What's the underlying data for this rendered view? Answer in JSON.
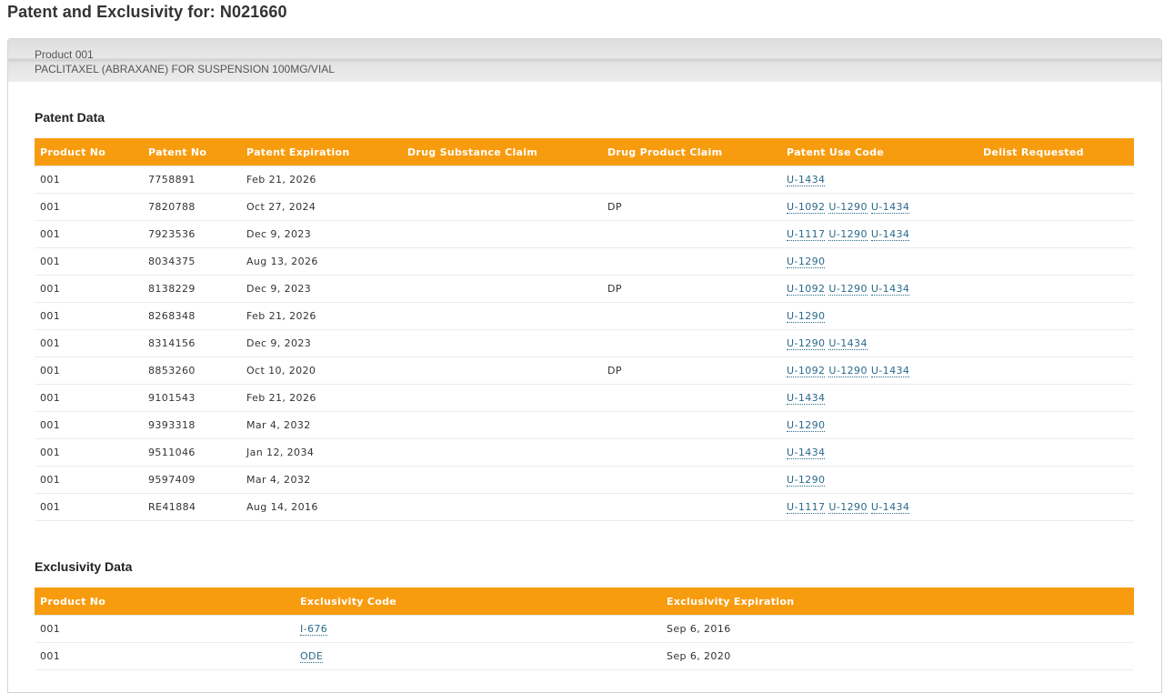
{
  "page_title": "Patent and Exclusivity for: N021660",
  "product": {
    "label": "Product 001",
    "description": "PACLITAXEL (ABRAXANE) FOR SUSPENSION 100MG/VIAL"
  },
  "patent_section": {
    "title": "Patent Data",
    "columns": [
      "Product No",
      "Patent No",
      "Patent Expiration",
      "Drug Substance Claim",
      "Drug Product Claim",
      "Patent Use Code",
      "Delist Requested"
    ],
    "rows": [
      {
        "product_no": "001",
        "patent_no": "7758891",
        "expiration": "Feb 21, 2026",
        "substance": "",
        "product_claim": "",
        "use_codes": [
          "U-1434"
        ],
        "delist": ""
      },
      {
        "product_no": "001",
        "patent_no": "7820788",
        "expiration": "Oct 27, 2024",
        "substance": "",
        "product_claim": "DP",
        "use_codes": [
          "U-1092",
          "U-1290",
          "U-1434"
        ],
        "delist": ""
      },
      {
        "product_no": "001",
        "patent_no": "7923536",
        "expiration": "Dec 9, 2023",
        "substance": "",
        "product_claim": "",
        "use_codes": [
          "U-1117",
          "U-1290",
          "U-1434"
        ],
        "delist": ""
      },
      {
        "product_no": "001",
        "patent_no": "8034375",
        "expiration": "Aug 13, 2026",
        "substance": "",
        "product_claim": "",
        "use_codes": [
          "U-1290"
        ],
        "delist": ""
      },
      {
        "product_no": "001",
        "patent_no": "8138229",
        "expiration": "Dec 9, 2023",
        "substance": "",
        "product_claim": "DP",
        "use_codes": [
          "U-1092",
          "U-1290",
          "U-1434"
        ],
        "delist": ""
      },
      {
        "product_no": "001",
        "patent_no": "8268348",
        "expiration": "Feb 21, 2026",
        "substance": "",
        "product_claim": "",
        "use_codes": [
          "U-1290"
        ],
        "delist": ""
      },
      {
        "product_no": "001",
        "patent_no": "8314156",
        "expiration": "Dec 9, 2023",
        "substance": "",
        "product_claim": "",
        "use_codes": [
          "U-1290",
          "U-1434"
        ],
        "delist": ""
      },
      {
        "product_no": "001",
        "patent_no": "8853260",
        "expiration": "Oct 10, 2020",
        "substance": "",
        "product_claim": "DP",
        "use_codes": [
          "U-1092",
          "U-1290",
          "U-1434"
        ],
        "delist": ""
      },
      {
        "product_no": "001",
        "patent_no": "9101543",
        "expiration": "Feb 21, 2026",
        "substance": "",
        "product_claim": "",
        "use_codes": [
          "U-1434"
        ],
        "delist": ""
      },
      {
        "product_no": "001",
        "patent_no": "9393318",
        "expiration": "Mar 4, 2032",
        "substance": "",
        "product_claim": "",
        "use_codes": [
          "U-1290"
        ],
        "delist": ""
      },
      {
        "product_no": "001",
        "patent_no": "9511046",
        "expiration": "Jan 12, 2034",
        "substance": "",
        "product_claim": "",
        "use_codes": [
          "U-1434"
        ],
        "delist": ""
      },
      {
        "product_no": "001",
        "patent_no": "9597409",
        "expiration": "Mar 4, 2032",
        "substance": "",
        "product_claim": "",
        "use_codes": [
          "U-1290"
        ],
        "delist": ""
      },
      {
        "product_no": "001",
        "patent_no": "RE41884",
        "expiration": "Aug 14, 2016",
        "substance": "",
        "product_claim": "",
        "use_codes": [
          "U-1117",
          "U-1290",
          "U-1434"
        ],
        "delist": ""
      }
    ]
  },
  "exclusivity_section": {
    "title": "Exclusivity Data",
    "columns": [
      "Product No",
      "Exclusivity Code",
      "Exclusivity Expiration"
    ],
    "rows": [
      {
        "product_no": "001",
        "code": "I-676",
        "expiration": "Sep 6, 2016"
      },
      {
        "product_no": "001",
        "code": "ODE",
        "expiration": "Sep 6, 2020"
      }
    ]
  },
  "colors": {
    "header_orange": "#f89c0f",
    "link": "#2a6a8a"
  }
}
